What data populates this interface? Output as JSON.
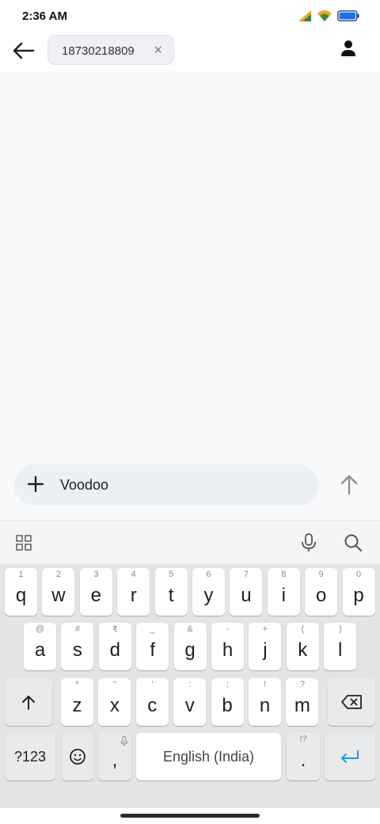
{
  "status": {
    "time": "2:36 AM"
  },
  "recipient": {
    "number": "18730218809"
  },
  "composer": {
    "text": "Voodoo"
  },
  "keyboard": {
    "row1": [
      {
        "key": "q",
        "hint": "1"
      },
      {
        "key": "w",
        "hint": "2"
      },
      {
        "key": "e",
        "hint": "3"
      },
      {
        "key": "r",
        "hint": "4"
      },
      {
        "key": "t",
        "hint": "5"
      },
      {
        "key": "y",
        "hint": "6"
      },
      {
        "key": "u",
        "hint": "7"
      },
      {
        "key": "i",
        "hint": "8"
      },
      {
        "key": "o",
        "hint": "9"
      },
      {
        "key": "p",
        "hint": "0"
      }
    ],
    "row2": [
      {
        "key": "a",
        "hint": "@"
      },
      {
        "key": "s",
        "hint": "#"
      },
      {
        "key": "d",
        "hint": "₹"
      },
      {
        "key": "f",
        "hint": "_"
      },
      {
        "key": "g",
        "hint": "&"
      },
      {
        "key": "h",
        "hint": "-"
      },
      {
        "key": "j",
        "hint": "+"
      },
      {
        "key": "k",
        "hint": "("
      },
      {
        "key": "l",
        "hint": ")"
      }
    ],
    "row3": [
      {
        "key": "z",
        "hint": "*"
      },
      {
        "key": "x",
        "hint": "\""
      },
      {
        "key": "c",
        "hint": "'"
      },
      {
        "key": "v",
        "hint": ":"
      },
      {
        "key": "b",
        "hint": ";"
      },
      {
        "key": "n",
        "hint": "!"
      },
      {
        "key": "m",
        "hint": "?"
      }
    ],
    "symbols_label": "?123",
    "comma_label": ",",
    "space_label": "English (India)",
    "period_label": ".",
    "period_hint": "!?"
  },
  "icons": {
    "back": "arrow-left-icon",
    "close": "close-icon",
    "contact": "person-icon",
    "add": "plus-icon",
    "send": "arrow-up-icon",
    "apps": "grid-icon",
    "mic": "microphone-icon",
    "search": "search-icon",
    "shift": "shift-icon",
    "backspace": "backspace-icon",
    "emoji": "emoji-icon",
    "enter": "enter-icon"
  },
  "colors": {
    "accent": "#1a9be6",
    "battery": "#1e6fe0",
    "signal": "#f2a31b",
    "wifi": "#2e8b3e"
  }
}
